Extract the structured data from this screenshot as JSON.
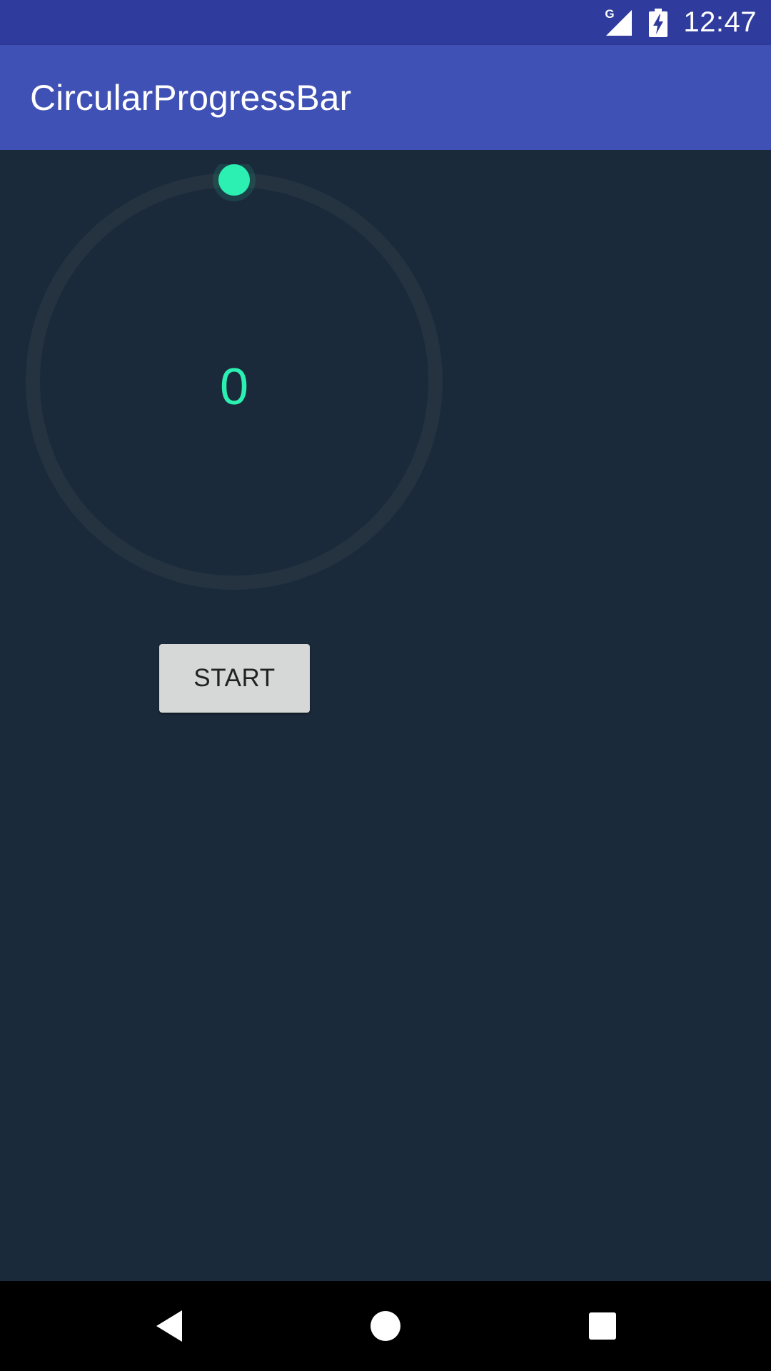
{
  "status_bar": {
    "network_label": "G",
    "time": "12:47",
    "icons": [
      "signal-icon",
      "battery-charging-icon"
    ]
  },
  "app_bar": {
    "title": "CircularProgressBar"
  },
  "progress": {
    "value_text": "0",
    "fraction": 0,
    "track_color": "#24333f",
    "progress_color": "#2bf0b2"
  },
  "controls": {
    "start_label": "START"
  },
  "nav_bar": {
    "icons": [
      "back-icon",
      "home-icon",
      "recents-icon"
    ]
  },
  "colors": {
    "status_bar": "#2f3c9e",
    "app_bar": "#3f51b5",
    "background": "#1b2a3b",
    "accent": "#2bf0b2"
  }
}
